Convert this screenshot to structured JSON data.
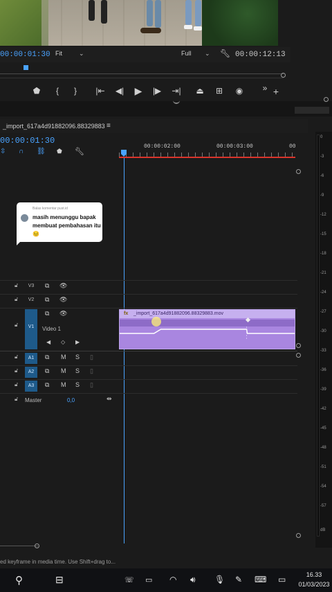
{
  "program_monitor": {
    "current_time": "00:00:01:30",
    "fit_select": "Fit",
    "quality_select": "Full",
    "duration": "00:00:12:13"
  },
  "transport": {
    "buttons": [
      "add-marker",
      "mark-in",
      "mark-out",
      "go-to-in",
      "step-back",
      "play",
      "step-forward",
      "go-to-out",
      "lift",
      "extract",
      "export-frame",
      "more",
      "add"
    ]
  },
  "sequence": {
    "tab_title": "_import_617a4d91882096.88329883",
    "tab_menu": "≡",
    "current_time": "00:00:01:30",
    "ruler_labels": [
      "00:00:02:00",
      "00:00:03:00",
      "00"
    ]
  },
  "tracks": {
    "video": [
      {
        "label": "V3"
      },
      {
        "label": "V2"
      },
      {
        "label": "V1",
        "name": "Video 1"
      }
    ],
    "audio": [
      {
        "label": "A1",
        "mute": "M",
        "solo": "S"
      },
      {
        "label": "A2",
        "mute": "M",
        "solo": "S"
      },
      {
        "label": "A3",
        "mute": "M",
        "solo": "S"
      }
    ],
    "master": {
      "label": "Master",
      "value": "0,0"
    }
  },
  "clip": {
    "fx": "fx",
    "name": "_import_617a4d91882096.88329883.mov"
  },
  "comment_overlay": {
    "header": "Balas komentar pust.id",
    "message": "masih menunggu bapak membuat pembahasan itu😣"
  },
  "audio_meter": {
    "scale": [
      "0",
      "-3",
      "-6",
      "-9",
      "-12",
      "-15",
      "-18",
      "-21",
      "-24",
      "-27",
      "-30",
      "-33",
      "-36",
      "-39",
      "-42",
      "-45",
      "-48",
      "-51",
      "-54",
      "-57",
      "dB"
    ]
  },
  "status_bar": {
    "text": "ed keyframe in media time. Use Shift+drag to..."
  },
  "taskbar": {
    "time": "16.33",
    "date": "01/03/2023"
  }
}
